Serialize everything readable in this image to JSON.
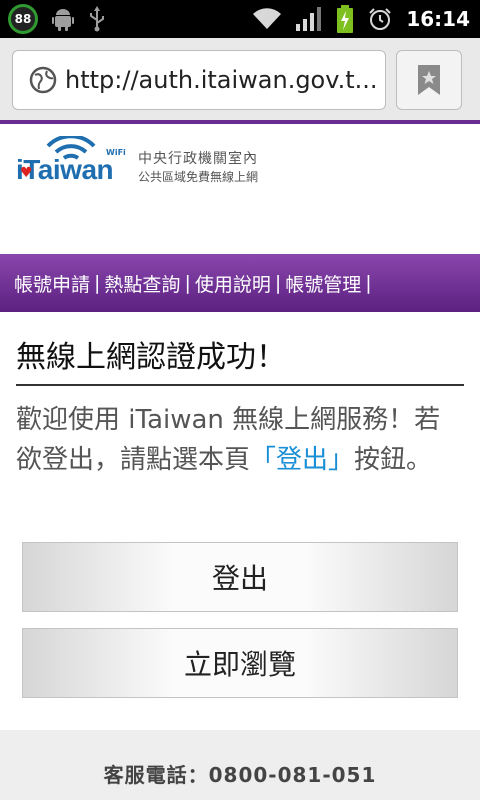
{
  "statusbar": {
    "notification_count": "88",
    "time": "16:14",
    "icons": [
      "android-icon",
      "usb-icon",
      "wifi-icon",
      "signal-icon",
      "battery-charging-icon",
      "alarm-icon"
    ]
  },
  "browser": {
    "url": "http://auth.itaiwan.gov.t...",
    "icons": [
      "globe-icon",
      "bookmark-icon"
    ]
  },
  "logo": {
    "word": "Taiwan",
    "letter_i": "i",
    "wifi_label": "WiFi",
    "line1": "中央行政機關室內",
    "line2": "公共區域免費無線上網"
  },
  "nav": {
    "items": [
      {
        "label": "帳號申請"
      },
      {
        "label": "熱點查詢"
      },
      {
        "label": "使用說明"
      },
      {
        "label": "帳號管理"
      }
    ],
    "separator": "|"
  },
  "main": {
    "heading": "無線上網認證成功！",
    "message_prefix": "歡迎使用 iTaiwan 無線上網服務！若欲登出，請點選本頁",
    "message_link": "「登出」",
    "message_suffix": "按鈕。"
  },
  "buttons": {
    "logout": "登出",
    "browse": "立即瀏覽"
  },
  "footer": {
    "text": "客服電話：0800-081-051"
  },
  "colors": {
    "accent_purple": "#6a2c91",
    "link_blue": "#1a8fd6",
    "logo_blue": "#1f6fb0"
  }
}
